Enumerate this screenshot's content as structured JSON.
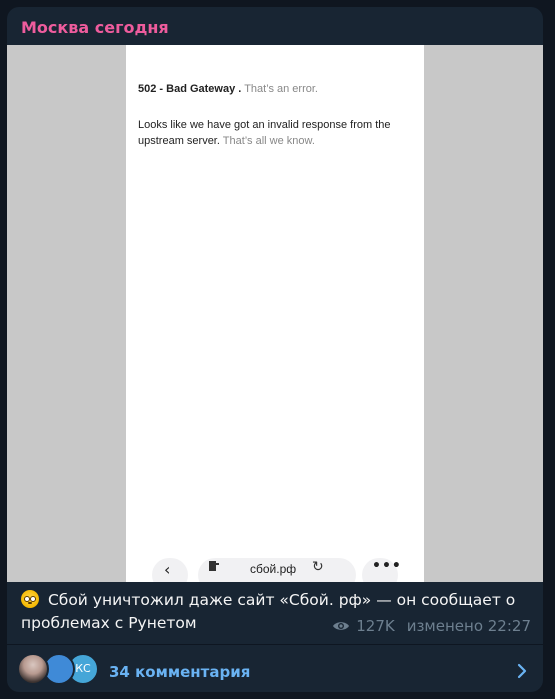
{
  "channel": {
    "name": "Москва сегодня"
  },
  "screenshot": {
    "error_title": "502 - Bad Gateway .",
    "error_suffix": "That’s an error.",
    "error_body": "Looks like we have got an invalid response from the upstream server.",
    "error_body_suffix": "That’s all we know.",
    "browser": {
      "url": "сбой.рф",
      "back_icon": "chevron-left-icon",
      "tab_icon": "tabs-icon",
      "reload_icon": "reload-icon",
      "more_icon": "more-horizontal-icon"
    }
  },
  "post": {
    "emoji": "flushed-face-emoji",
    "text": "Сбой уничтожил даже сайт «Сбой. рф» — он сообщает о проблемах с Рунетом",
    "views": "127K",
    "edited": "изменено 22:27"
  },
  "comments": {
    "label": "34 комментария",
    "avatar3_initials": "КС"
  },
  "colors": {
    "background": "#0f1620",
    "bubble": "#182533",
    "channel_name": "#ee5c9d",
    "link": "#6ab3f3",
    "meta": "#6d7f8f"
  }
}
